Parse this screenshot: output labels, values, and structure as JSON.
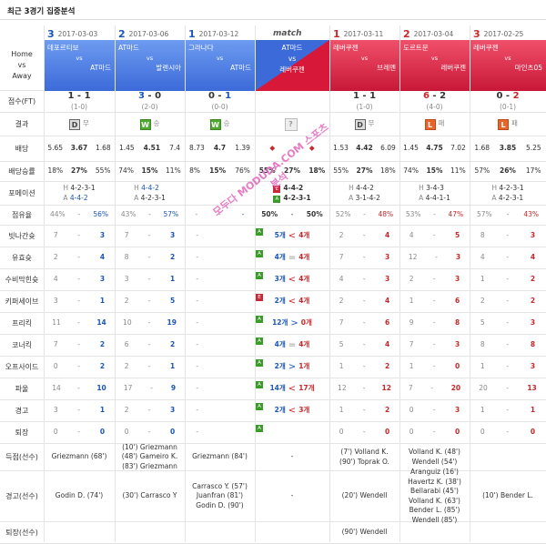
{
  "header": {
    "title": "최근 3경기 집중분석"
  },
  "labels": {
    "home_vs_away": [
      "Home",
      "vs",
      "Away"
    ],
    "score": "점수(FT)",
    "result": "결과",
    "odds": "배당",
    "odds_rate": "배당승률",
    "formation": "포메이션",
    "possession": "점유율",
    "shots_missed": "빗나간슛",
    "shots_on": "유효슛",
    "saves_def": "수비막힌슛",
    "keeper_saves": "키퍼세이브",
    "free_kicks": "프리킥",
    "corners": "코너킥",
    "offsides": "오프사이드",
    "fouls": "파울",
    "cards": "경고",
    "redcards": "퇴장",
    "goals_players": "득점(선수)",
    "cards_players": "경고(선수)",
    "red_players": "퇴장(선수)"
  },
  "match_label": "match",
  "vs": "vs",
  "cols": [
    {
      "num": "3",
      "date": "2017-03-03",
      "home": "데포르티보",
      "away": "AT마드",
      "score_a": "1",
      "score_sep": "-",
      "score_b": "1",
      "ht": "(1-0)",
      "res": "D",
      "res_txt": "무",
      "odds": [
        "5.65",
        "3.67",
        "1.68"
      ],
      "rate": [
        "18%",
        "27%",
        "55%"
      ],
      "form_h": "4-2-3-1",
      "form_a": "4-4-2",
      "poss": [
        "44%",
        "-",
        "56%"
      ],
      "s1": [
        "7",
        "-",
        "3"
      ],
      "s2": [
        "2",
        "-",
        "4"
      ],
      "s3": [
        "4",
        "-",
        "3"
      ],
      "s4": [
        "3",
        "-",
        "1"
      ],
      "s5": [
        "11",
        "-",
        "14"
      ],
      "s6": [
        "7",
        "-",
        "2"
      ],
      "s7": [
        "0",
        "-",
        "2"
      ],
      "s8": [
        "14",
        "-",
        "10"
      ],
      "s9": [
        "3",
        "-",
        "1"
      ],
      "s10": [
        "0",
        "-",
        "0"
      ],
      "goals": "Griezmann (68')",
      "cards": "Godin D. (74')",
      "red": ""
    },
    {
      "num": "2",
      "date": "2017-03-06",
      "home": "AT마드",
      "away": "발렌시아",
      "score_a": "3",
      "score_sep": "-",
      "score_b": "0",
      "ht": "(2-0)",
      "res": "W",
      "res_txt": "승",
      "odds": [
        "1.45",
        "4.51",
        "7.4"
      ],
      "rate": [
        "74%",
        "15%",
        "11%"
      ],
      "form_h": "4-4-2",
      "form_a": "4-2-3-1",
      "poss": [
        "43%",
        "-",
        "57%"
      ],
      "s1": [
        "7",
        "-",
        "3"
      ],
      "s2": [
        "8",
        "-",
        "2"
      ],
      "s3": [
        "3",
        "-",
        "1"
      ],
      "s4": [
        "2",
        "-",
        "5"
      ],
      "s5": [
        "10",
        "-",
        "19"
      ],
      "s6": [
        "6",
        "-",
        "2"
      ],
      "s7": [
        "2",
        "-",
        "1"
      ],
      "s8": [
        "17",
        "-",
        "9"
      ],
      "s9": [
        "2",
        "-",
        "3"
      ],
      "s10": [
        "0",
        "-",
        "0"
      ],
      "goals": "(10') Griezmann\n(48') Gameiro K.\n(83') Griezmann",
      "cards": "(30') Carrasco Y",
      "red": ""
    },
    {
      "num": "1",
      "date": "2017-03-12",
      "home": "그라나다",
      "away": "AT마드",
      "score_a": "0",
      "score_sep": "-",
      "score_b": "1",
      "ht": "(0-0)",
      "res": "W",
      "res_txt": "승",
      "odds": [
        "8.73",
        "4.7",
        "1.39"
      ],
      "rate": [
        "8%",
        "15%",
        "76%"
      ],
      "form_h": "",
      "form_a": "",
      "poss": [
        "-",
        "-",
        "-"
      ],
      "s1": [
        "-",
        "",
        ""
      ],
      "s2": [
        "-",
        "",
        ""
      ],
      "s3": [
        "-",
        "",
        ""
      ],
      "s4": [
        "-",
        "",
        ""
      ],
      "s5": [
        "-",
        "",
        ""
      ],
      "s6": [
        "-",
        "",
        ""
      ],
      "s7": [
        "-",
        "",
        ""
      ],
      "s8": [
        "-",
        "",
        ""
      ],
      "s9": [
        "-",
        "",
        ""
      ],
      "s10": [
        "-",
        "",
        ""
      ],
      "goals": "Griezmann (84')",
      "cards": "Carrasco Y. (57')\nJuanfran (81')\nGodin D. (90')",
      "red": ""
    },
    {
      "num": "1",
      "date": "2017-03-11",
      "home": "레버쿠젠",
      "away": "브레멘",
      "score_a": "1",
      "score_sep": "-",
      "score_b": "1",
      "ht": "(1-0)",
      "res": "D",
      "res_txt": "무",
      "odds": [
        "1.53",
        "4.42",
        "6.09"
      ],
      "rate": [
        "55%",
        "27%",
        "18%"
      ],
      "form_h": "4-4-2",
      "form_a": "3-1-4-2",
      "poss": [
        "52%",
        "-",
        "48%"
      ],
      "s1": [
        "2",
        "-",
        "4"
      ],
      "s2": [
        "7",
        "-",
        "3"
      ],
      "s3": [
        "4",
        "-",
        "3"
      ],
      "s4": [
        "2",
        "-",
        "4"
      ],
      "s5": [
        "7",
        "-",
        "6"
      ],
      "s6": [
        "5",
        "-",
        "4"
      ],
      "s7": [
        "1",
        "-",
        "2"
      ],
      "s8": [
        "12",
        "-",
        "12"
      ],
      "s9": [
        "1",
        "-",
        "2"
      ],
      "s10": [
        "0",
        "-",
        "0"
      ],
      "goals": "(7') Volland K.\n(90') Toprak O.",
      "cards": "(20') Wendell",
      "red": "(90') Wendell"
    },
    {
      "num": "2",
      "date": "2017-03-04",
      "home": "도르트문",
      "away": "레버쿠젠",
      "score_a": "6",
      "score_sep": "-",
      "score_b": "2",
      "ht": "(4-0)",
      "res": "L",
      "res_txt": "패",
      "odds": [
        "1.45",
        "4.75",
        "7.02"
      ],
      "rate": [
        "74%",
        "15%",
        "11%"
      ],
      "form_h": "3-4-3",
      "form_a": "4-4-1-1",
      "poss": [
        "53%",
        "-",
        "47%"
      ],
      "s1": [
        "4",
        "-",
        "5"
      ],
      "s2": [
        "12",
        "-",
        "3"
      ],
      "s3": [
        "2",
        "-",
        "3"
      ],
      "s4": [
        "1",
        "-",
        "6"
      ],
      "s5": [
        "9",
        "-",
        "8"
      ],
      "s6": [
        "7",
        "-",
        "3"
      ],
      "s7": [
        "1",
        "-",
        "0"
      ],
      "s8": [
        "7",
        "-",
        "20"
      ],
      "s9": [
        "0",
        "-",
        "3"
      ],
      "s10": [
        "0",
        "-",
        "0"
      ],
      "goals": "Volland K. (48')\nWendell (54')",
      "cards": "Aranguiz (16')\nHavertz K. (38')\nBellarabi (45')\nVolland K. (63')\nBender L. (85')\nWendell (85')",
      "red": ""
    },
    {
      "num": "3",
      "date": "2017-02-25",
      "home": "레버쿠젠",
      "away": "마인츠05",
      "score_a": "0",
      "score_sep": "-",
      "score_b": "2",
      "ht": "(0-1)",
      "res": "L",
      "res_txt": "패",
      "odds": [
        "1.68",
        "3.85",
        "5.25"
      ],
      "rate": [
        "57%",
        "26%",
        "17%"
      ],
      "form_h": "4-2-3-1",
      "form_a": "4-2-3-1",
      "poss": [
        "57%",
        "-",
        "43%"
      ],
      "s1": [
        "8",
        "-",
        "3"
      ],
      "s2": [
        "4",
        "-",
        "4"
      ],
      "s3": [
        "1",
        "-",
        "2"
      ],
      "s4": [
        "2",
        "-",
        "2"
      ],
      "s5": [
        "5",
        "-",
        "3"
      ],
      "s6": [
        "8",
        "-",
        "8"
      ],
      "s7": [
        "1",
        "-",
        "3"
      ],
      "s8": [
        "20",
        "-",
        "13"
      ],
      "s9": [
        "1",
        "-",
        "1"
      ],
      "s10": [
        "0",
        "-",
        "0"
      ],
      "goals": "",
      "cards": "(10') Bender L.",
      "red": ""
    }
  ],
  "match": {
    "home": "AT마드",
    "away": "레버쿠젠",
    "score": "?",
    "rate": [
      "55%",
      "27%",
      "18%"
    ],
    "form_h": "4-4-2",
    "form_a": "4-2-3-1",
    "poss": [
      "50%",
      "-",
      "50%"
    ],
    "stats": [
      {
        "tag": "A",
        "a": "5개",
        "b": "4개",
        "dir": "<"
      },
      {
        "tag": "A",
        "a": "4개",
        "b": "4개",
        "dir": "="
      },
      {
        "tag": "A",
        "a": "3개",
        "b": "4개",
        "dir": "<"
      },
      {
        "tag": "E",
        "a": "2개",
        "b": "4개",
        "dir": "<"
      },
      {
        "tag": "A",
        "a": "12개",
        "b": "0개",
        "dir": ">"
      },
      {
        "tag": "A",
        "a": "4개",
        "b": "4개",
        "dir": "="
      },
      {
        "tag": "A",
        "a": "2개",
        "b": "1개",
        "dir": ">"
      },
      {
        "tag": "A",
        "a": "14개",
        "b": "17개",
        "dir": "<"
      },
      {
        "tag": "A",
        "a": "2개",
        "b": "3개",
        "dir": "<"
      },
      {
        "tag": "A",
        "a": "",
        "b": "",
        "dir": ""
      }
    ],
    "goals": "-",
    "cards": "-",
    "red": ""
  },
  "watermark": "모두다 MODUDA.COM 스포츠 분석"
}
